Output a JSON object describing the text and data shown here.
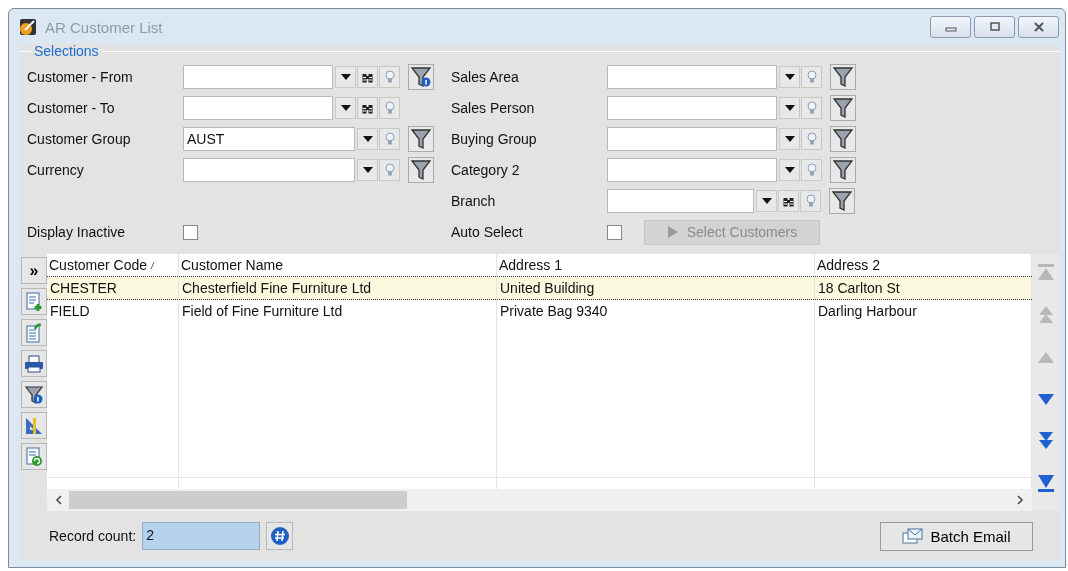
{
  "window": {
    "title": "AR Customer List"
  },
  "selections": {
    "legend": "Selections",
    "left_rows": [
      {
        "label": "Customer - From",
        "binoculars": true,
        "filter_button": true,
        "filter_info": true
      },
      {
        "label": "Customer - To",
        "binoculars": true,
        "filter_button": false,
        "filter_info": false
      },
      {
        "label": "Customer Group",
        "value": "AUST",
        "binoculars": false,
        "filter_button": true,
        "filter_info": false
      },
      {
        "label": "Currency",
        "binoculars": false,
        "filter_button": true,
        "filter_info": false
      }
    ],
    "right_rows": [
      {
        "label": "Sales Area",
        "binoculars": false,
        "filter_button": true,
        "filter_info": false
      },
      {
        "label": "Sales Person",
        "binoculars": false,
        "filter_button": true,
        "filter_info": false
      },
      {
        "label": "Buying Group",
        "binoculars": false,
        "filter_button": true,
        "filter_info": false
      },
      {
        "label": "Category 2",
        "binoculars": false,
        "filter_button": true,
        "filter_info": false
      },
      {
        "label": "Branch",
        "binoculars": true,
        "filter_button": true,
        "filter_info": false
      }
    ],
    "display_inactive": {
      "label": "Display Inactive",
      "checked": false
    },
    "auto_select": {
      "label": "Auto Select",
      "checked": false
    },
    "select_button": {
      "label": "Select Customers",
      "disabled": true
    }
  },
  "toolbar": {
    "expand_glyph": "»"
  },
  "table": {
    "columns": [
      {
        "label": "Customer Code",
        "sorted": true
      },
      {
        "label": "Customer Name",
        "sorted": false
      },
      {
        "label": "Address 1",
        "sorted": false
      },
      {
        "label": "Address 2",
        "sorted": false
      }
    ],
    "rows": [
      {
        "cells": [
          "CHESTER",
          "Chesterfield Fine Furniture Ltd",
          "United Building",
          "18 Carlton St"
        ],
        "selected": true
      },
      {
        "cells": [
          "FIELD",
          "Field of Fine Furniture Ltd",
          "Private Bag 9340",
          "Darling Harbour"
        ],
        "selected": false
      }
    ]
  },
  "nav_buttons": [
    {
      "kind": "first",
      "disabled": true
    },
    {
      "kind": "page_up",
      "disabled": true
    },
    {
      "kind": "up",
      "disabled": true
    },
    {
      "kind": "down",
      "disabled": false
    },
    {
      "kind": "page_down",
      "disabled": false
    },
    {
      "kind": "last",
      "disabled": false
    }
  ],
  "footer": {
    "record_count_label": "Record count:",
    "record_count": "2",
    "email_button": "Batch Email"
  }
}
